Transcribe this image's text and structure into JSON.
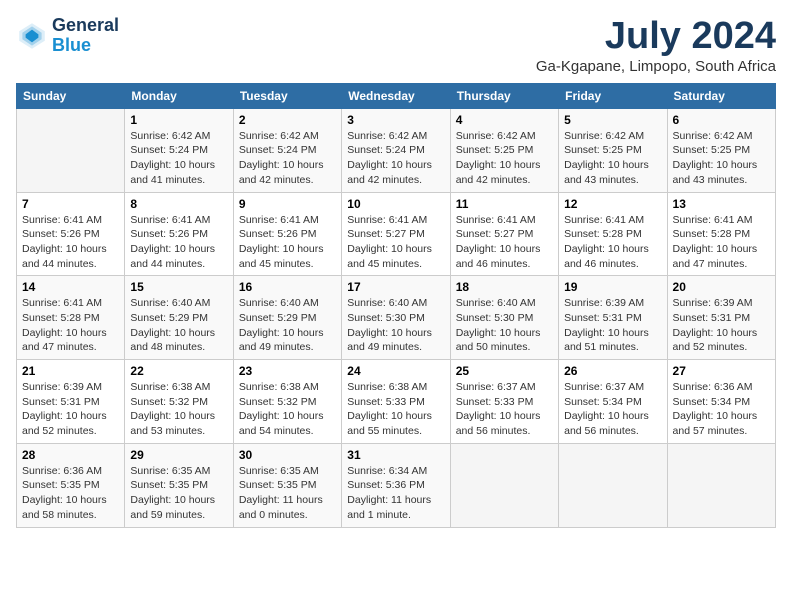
{
  "header": {
    "logo_line1": "General",
    "logo_line2": "Blue",
    "month": "July 2024",
    "location": "Ga-Kgapane, Limpopo, South Africa"
  },
  "weekdays": [
    "Sunday",
    "Monday",
    "Tuesday",
    "Wednesday",
    "Thursday",
    "Friday",
    "Saturday"
  ],
  "weeks": [
    [
      {
        "day": "",
        "info": ""
      },
      {
        "day": "1",
        "info": "Sunrise: 6:42 AM\nSunset: 5:24 PM\nDaylight: 10 hours\nand 41 minutes."
      },
      {
        "day": "2",
        "info": "Sunrise: 6:42 AM\nSunset: 5:24 PM\nDaylight: 10 hours\nand 42 minutes."
      },
      {
        "day": "3",
        "info": "Sunrise: 6:42 AM\nSunset: 5:24 PM\nDaylight: 10 hours\nand 42 minutes."
      },
      {
        "day": "4",
        "info": "Sunrise: 6:42 AM\nSunset: 5:25 PM\nDaylight: 10 hours\nand 42 minutes."
      },
      {
        "day": "5",
        "info": "Sunrise: 6:42 AM\nSunset: 5:25 PM\nDaylight: 10 hours\nand 43 minutes."
      },
      {
        "day": "6",
        "info": "Sunrise: 6:42 AM\nSunset: 5:25 PM\nDaylight: 10 hours\nand 43 minutes."
      }
    ],
    [
      {
        "day": "7",
        "info": "Sunrise: 6:41 AM\nSunset: 5:26 PM\nDaylight: 10 hours\nand 44 minutes."
      },
      {
        "day": "8",
        "info": "Sunrise: 6:41 AM\nSunset: 5:26 PM\nDaylight: 10 hours\nand 44 minutes."
      },
      {
        "day": "9",
        "info": "Sunrise: 6:41 AM\nSunset: 5:26 PM\nDaylight: 10 hours\nand 45 minutes."
      },
      {
        "day": "10",
        "info": "Sunrise: 6:41 AM\nSunset: 5:27 PM\nDaylight: 10 hours\nand 45 minutes."
      },
      {
        "day": "11",
        "info": "Sunrise: 6:41 AM\nSunset: 5:27 PM\nDaylight: 10 hours\nand 46 minutes."
      },
      {
        "day": "12",
        "info": "Sunrise: 6:41 AM\nSunset: 5:28 PM\nDaylight: 10 hours\nand 46 minutes."
      },
      {
        "day": "13",
        "info": "Sunrise: 6:41 AM\nSunset: 5:28 PM\nDaylight: 10 hours\nand 47 minutes."
      }
    ],
    [
      {
        "day": "14",
        "info": "Sunrise: 6:41 AM\nSunset: 5:28 PM\nDaylight: 10 hours\nand 47 minutes."
      },
      {
        "day": "15",
        "info": "Sunrise: 6:40 AM\nSunset: 5:29 PM\nDaylight: 10 hours\nand 48 minutes."
      },
      {
        "day": "16",
        "info": "Sunrise: 6:40 AM\nSunset: 5:29 PM\nDaylight: 10 hours\nand 49 minutes."
      },
      {
        "day": "17",
        "info": "Sunrise: 6:40 AM\nSunset: 5:30 PM\nDaylight: 10 hours\nand 49 minutes."
      },
      {
        "day": "18",
        "info": "Sunrise: 6:40 AM\nSunset: 5:30 PM\nDaylight: 10 hours\nand 50 minutes."
      },
      {
        "day": "19",
        "info": "Sunrise: 6:39 AM\nSunset: 5:31 PM\nDaylight: 10 hours\nand 51 minutes."
      },
      {
        "day": "20",
        "info": "Sunrise: 6:39 AM\nSunset: 5:31 PM\nDaylight: 10 hours\nand 52 minutes."
      }
    ],
    [
      {
        "day": "21",
        "info": "Sunrise: 6:39 AM\nSunset: 5:31 PM\nDaylight: 10 hours\nand 52 minutes."
      },
      {
        "day": "22",
        "info": "Sunrise: 6:38 AM\nSunset: 5:32 PM\nDaylight: 10 hours\nand 53 minutes."
      },
      {
        "day": "23",
        "info": "Sunrise: 6:38 AM\nSunset: 5:32 PM\nDaylight: 10 hours\nand 54 minutes."
      },
      {
        "day": "24",
        "info": "Sunrise: 6:38 AM\nSunset: 5:33 PM\nDaylight: 10 hours\nand 55 minutes."
      },
      {
        "day": "25",
        "info": "Sunrise: 6:37 AM\nSunset: 5:33 PM\nDaylight: 10 hours\nand 56 minutes."
      },
      {
        "day": "26",
        "info": "Sunrise: 6:37 AM\nSunset: 5:34 PM\nDaylight: 10 hours\nand 56 minutes."
      },
      {
        "day": "27",
        "info": "Sunrise: 6:36 AM\nSunset: 5:34 PM\nDaylight: 10 hours\nand 57 minutes."
      }
    ],
    [
      {
        "day": "28",
        "info": "Sunrise: 6:36 AM\nSunset: 5:35 PM\nDaylight: 10 hours\nand 58 minutes."
      },
      {
        "day": "29",
        "info": "Sunrise: 6:35 AM\nSunset: 5:35 PM\nDaylight: 10 hours\nand 59 minutes."
      },
      {
        "day": "30",
        "info": "Sunrise: 6:35 AM\nSunset: 5:35 PM\nDaylight: 11 hours\nand 0 minutes."
      },
      {
        "day": "31",
        "info": "Sunrise: 6:34 AM\nSunset: 5:36 PM\nDaylight: 11 hours\nand 1 minute."
      },
      {
        "day": "",
        "info": ""
      },
      {
        "day": "",
        "info": ""
      },
      {
        "day": "",
        "info": ""
      }
    ]
  ]
}
